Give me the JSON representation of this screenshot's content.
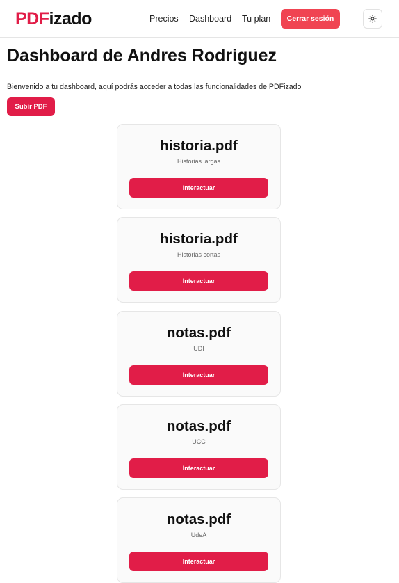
{
  "nav": {
    "logo_accent": "PDF",
    "logo_rest": "izado",
    "links": [
      "Precios",
      "Dashboard",
      "Tu plan"
    ],
    "logout_label": "Cerrar sesión",
    "theme_icon": "sun-icon"
  },
  "main": {
    "title": "Dashboard de Andres Rodriguez",
    "welcome": "Bienvenido a tu dashboard, aquí podrás acceder a todas las funcionalidades de PDFizado",
    "upload_label": "Subir PDF"
  },
  "documents": [
    {
      "name": "historia.pdf",
      "description": "Historias largas",
      "action": "Interactuar"
    },
    {
      "name": "historia.pdf",
      "description": "Historias cortas",
      "action": "Interactuar"
    },
    {
      "name": "notas.pdf",
      "description": "UDI",
      "action": "Interactuar"
    },
    {
      "name": "notas.pdf",
      "description": "UCC",
      "action": "Interactuar"
    },
    {
      "name": "notas.pdf",
      "description": "UdeA",
      "action": "Interactuar"
    }
  ],
  "colors": {
    "brand": "#e11d48",
    "logout": "#f04452",
    "card_bg": "#fafafa",
    "border": "#e6e6e6"
  }
}
